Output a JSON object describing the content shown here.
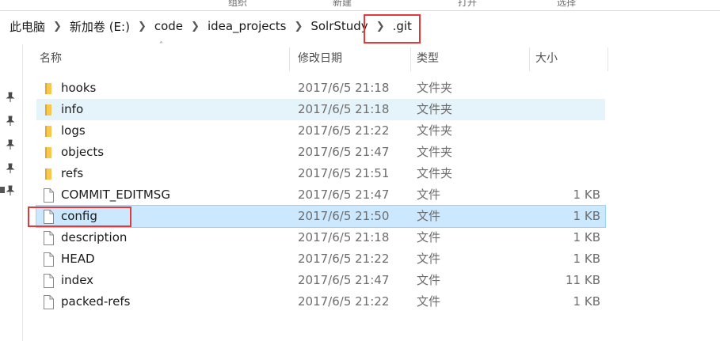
{
  "ribbon": {
    "labels": [
      "组织",
      "新建",
      "打开",
      "选择"
    ]
  },
  "breadcrumb": {
    "items": [
      "此电脑",
      "新加卷 (E:)",
      "code",
      "idea_projects",
      "SolrStudy",
      ".git"
    ]
  },
  "columns": {
    "name": "名称",
    "modified": "修改日期",
    "type": "类型",
    "size": "大小"
  },
  "files": [
    {
      "name": "hooks",
      "modified": "2017/6/5 21:18",
      "type": "文件夹",
      "size": "",
      "icon": "folder-icon"
    },
    {
      "name": "info",
      "modified": "2017/6/5 21:18",
      "type": "文件夹",
      "size": "",
      "icon": "folder-icon"
    },
    {
      "name": "logs",
      "modified": "2017/6/5 21:22",
      "type": "文件夹",
      "size": "",
      "icon": "folder-icon"
    },
    {
      "name": "objects",
      "modified": "2017/6/5 21:47",
      "type": "文件夹",
      "size": "",
      "icon": "folder-icon"
    },
    {
      "name": "refs",
      "modified": "2017/6/5 21:51",
      "type": "文件夹",
      "size": "",
      "icon": "folder-icon"
    },
    {
      "name": "COMMIT_EDITMSG",
      "modified": "2017/6/5 21:47",
      "type": "文件",
      "size": "1 KB",
      "icon": "file-icon"
    },
    {
      "name": "config",
      "modified": "2017/6/5 21:50",
      "type": "文件",
      "size": "1 KB",
      "icon": "file-icon"
    },
    {
      "name": "description",
      "modified": "2017/6/5 21:18",
      "type": "文件",
      "size": "1 KB",
      "icon": "file-icon"
    },
    {
      "name": "HEAD",
      "modified": "2017/6/5 21:22",
      "type": "文件",
      "size": "1 KB",
      "icon": "file-icon"
    },
    {
      "name": "index",
      "modified": "2017/6/5 21:47",
      "type": "文件",
      "size": "11 KB",
      "icon": "file-icon"
    },
    {
      "name": "packed-refs",
      "modified": "2017/6/5 21:22",
      "type": "文件",
      "size": "1 KB",
      "icon": "file-icon"
    }
  ],
  "colors": {
    "selected_row": "#cce8ff",
    "hover_row": "#e5f3fb",
    "highlight_box": "#e23a3a",
    "folder": "#f8c84a"
  }
}
